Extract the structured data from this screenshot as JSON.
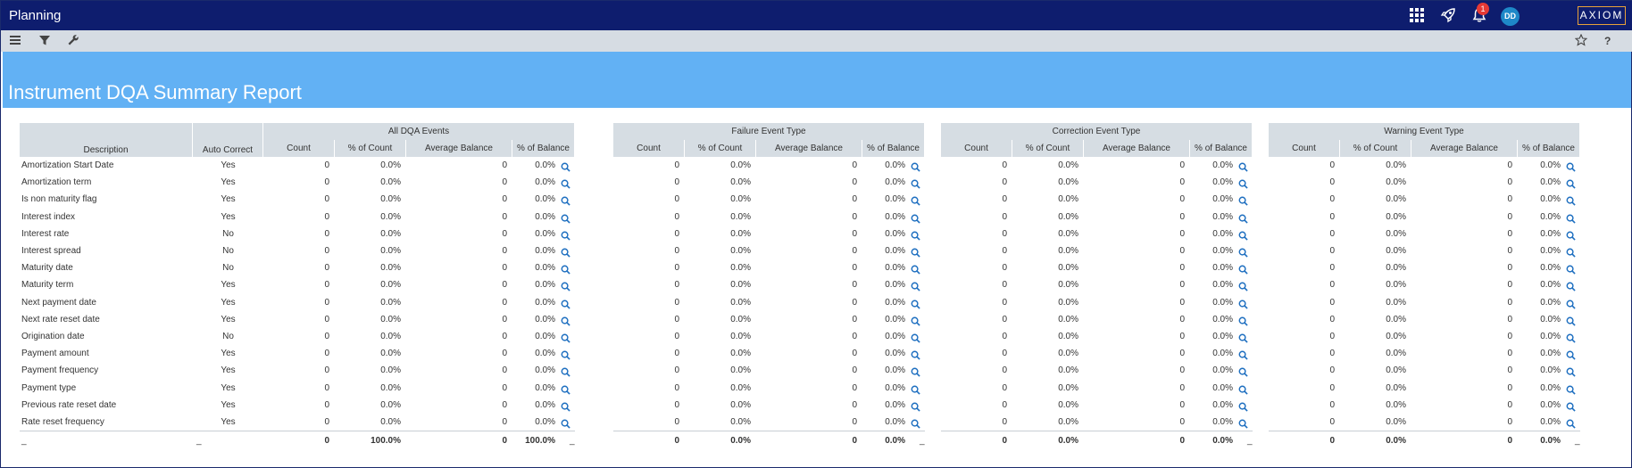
{
  "app": {
    "title": "Planning",
    "notification_count": "1",
    "user_initials": "DD",
    "logo": "AXIOM"
  },
  "icons": {
    "apps": "grid-icon",
    "launch": "rocket-icon",
    "notify": "bell-icon",
    "menu": "hamburger-icon",
    "filter": "filter-icon",
    "tools": "wrench-icon",
    "favorite": "star-icon",
    "help": "question-icon",
    "drill": "magnifier-icon"
  },
  "toolbar": {
    "help_label": "?"
  },
  "report": {
    "title": "Instrument DQA Summary Report"
  },
  "colors": {
    "topbar": "#0e1d6e",
    "banner": "#62b1f4",
    "header": "#d6dde3",
    "link": "#1e6fc0"
  },
  "table": {
    "left_headers": {
      "description": "Description",
      "auto_correct": "Auto Correct"
    },
    "groups": [
      "All DQA Events",
      "Failure Event Type",
      "Correction Event Type",
      "Warning Event Type"
    ],
    "columns": [
      "Count",
      "% of Count",
      "Average Balance",
      "% of Balance"
    ],
    "rows": [
      {
        "description": "Amortization Start Date",
        "auto": "Yes"
      },
      {
        "description": "Amortization term",
        "auto": "Yes"
      },
      {
        "description": "Is non maturity flag",
        "auto": "Yes"
      },
      {
        "description": "Interest index",
        "auto": "Yes"
      },
      {
        "description": "Interest rate",
        "auto": "No"
      },
      {
        "description": "Interest spread",
        "auto": "No"
      },
      {
        "description": "Maturity date",
        "auto": "No"
      },
      {
        "description": "Maturity term",
        "auto": "Yes"
      },
      {
        "description": "Next payment date",
        "auto": "Yes"
      },
      {
        "description": "Next rate reset date",
        "auto": "Yes"
      },
      {
        "description": "Origination date",
        "auto": "No"
      },
      {
        "description": "Payment amount",
        "auto": "Yes"
      },
      {
        "description": "Payment frequency",
        "auto": "Yes"
      },
      {
        "description": "Payment type",
        "auto": "Yes"
      },
      {
        "description": "Previous rate reset date",
        "auto": "Yes"
      },
      {
        "description": "Rate reset frequency",
        "auto": "Yes"
      }
    ],
    "cell_values": {
      "count": "0",
      "pct_count": "0.0%",
      "avg_balance": "0",
      "pct_balance": "0.0%"
    },
    "totals": [
      {
        "count": "0",
        "pct_count": "100.0%",
        "avg_balance": "0",
        "pct_balance": "100.0%"
      },
      {
        "count": "0",
        "pct_count": "0.0%",
        "avg_balance": "0",
        "pct_balance": "0.0%"
      },
      {
        "count": "0",
        "pct_count": "0.0%",
        "avg_balance": "0",
        "pct_balance": "0.0%"
      },
      {
        "count": "0",
        "pct_count": "0.0%",
        "avg_balance": "0",
        "pct_balance": "0.0%"
      }
    ],
    "total_marker": "_"
  }
}
